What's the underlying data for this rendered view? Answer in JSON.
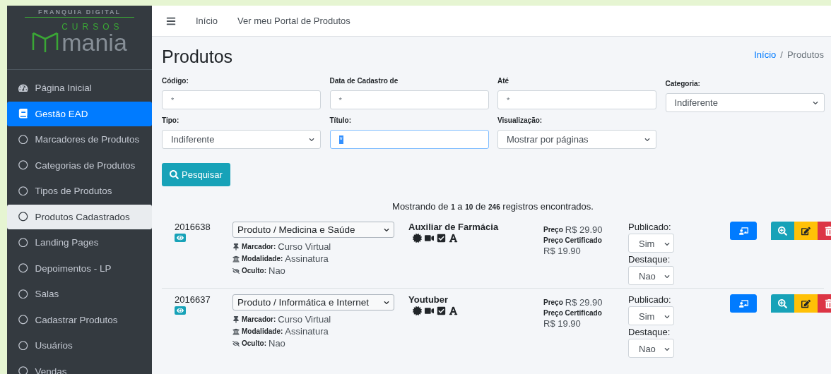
{
  "logo": {
    "tagline": "FRANQUIA DIGITAL",
    "top": "CURSOS",
    "bottom": "mania"
  },
  "sidebar": {
    "items": [
      {
        "label": "Página Inicial",
        "selected": false
      },
      {
        "label": "Gestão EAD",
        "open": true,
        "selected": false
      },
      {
        "label": "Marcadores de Produtos",
        "selected": false
      },
      {
        "label": "Categorias de Produtos",
        "selected": false
      },
      {
        "label": "Tipos de Produtos",
        "selected": false
      },
      {
        "label": "Produtos Cadastrados",
        "selected": true
      },
      {
        "label": "Landing Pages",
        "selected": false
      },
      {
        "label": "Depoimentos - LP",
        "selected": false
      },
      {
        "label": "Salas",
        "selected": false
      },
      {
        "label": "Cadastrar Produtos",
        "selected": false
      },
      {
        "label": "Usuários",
        "selected": false
      },
      {
        "label": "Vendas",
        "selected": false
      }
    ]
  },
  "topbar": {
    "links": [
      "Início",
      "Ver meu Portal de Produtos"
    ]
  },
  "page": {
    "title": "Produtos",
    "breadcrumb": [
      "Início",
      "Produtos"
    ],
    "breadcrumb_separator": "/"
  },
  "filters": [
    {
      "label": "Código:",
      "kind": "input",
      "value": "*"
    },
    {
      "label": "Data de Cadastro de",
      "kind": "input",
      "value": "*"
    },
    {
      "label": "Até",
      "kind": "input",
      "value": "*"
    },
    {
      "label": "Categoria:",
      "kind": "select",
      "value": "Indiferente"
    },
    {
      "label": "Tipo:",
      "kind": "select",
      "value": "Indiferente"
    },
    {
      "label": "Título:",
      "kind": "input",
      "value": "*",
      "focused": true
    },
    {
      "label": "Visualização:",
      "kind": "select",
      "value": "Mostrar por páginas"
    }
  ],
  "search_button": "Pesquisar",
  "summary": "Mostrando de **1** a **10** de **246** registros encontrados.",
  "products": [
    {
      "code": "2016638",
      "category": "Produto / Medicina e Saúde",
      "marker_label": "Marcador:",
      "marker": "Curso Virtual",
      "mode_label": "Modalidade:",
      "mode": "Assinatura",
      "hidden_label": "Oculto:",
      "hidden": "Nao",
      "title": "Auxiliar de Farmácia",
      "price_label": "Preço",
      "price": "R$ 29.90",
      "cert_label": "Preço Certificado",
      "cert_price": "R$ 19.90",
      "published_label": "Publicado:",
      "published": "Sim",
      "featured_label": "Destaque:",
      "featured": "Nao"
    },
    {
      "code": "2016637",
      "category": "Produto / Informática e Internet",
      "marker_label": "Marcador:",
      "marker": "Curso Virtual",
      "mode_label": "Modalidade:",
      "mode": "Assinatura",
      "hidden_label": "Oculto:",
      "hidden": "Nao",
      "title": "Youtuber",
      "price_label": "Preço",
      "price": "R$ 29.90",
      "cert_label": "Preço Certificado",
      "cert_price": "R$ 19.90",
      "published_label": "Publicado:",
      "published": "Sim",
      "featured_label": "Destaque:",
      "featured": "Nao"
    }
  ]
}
